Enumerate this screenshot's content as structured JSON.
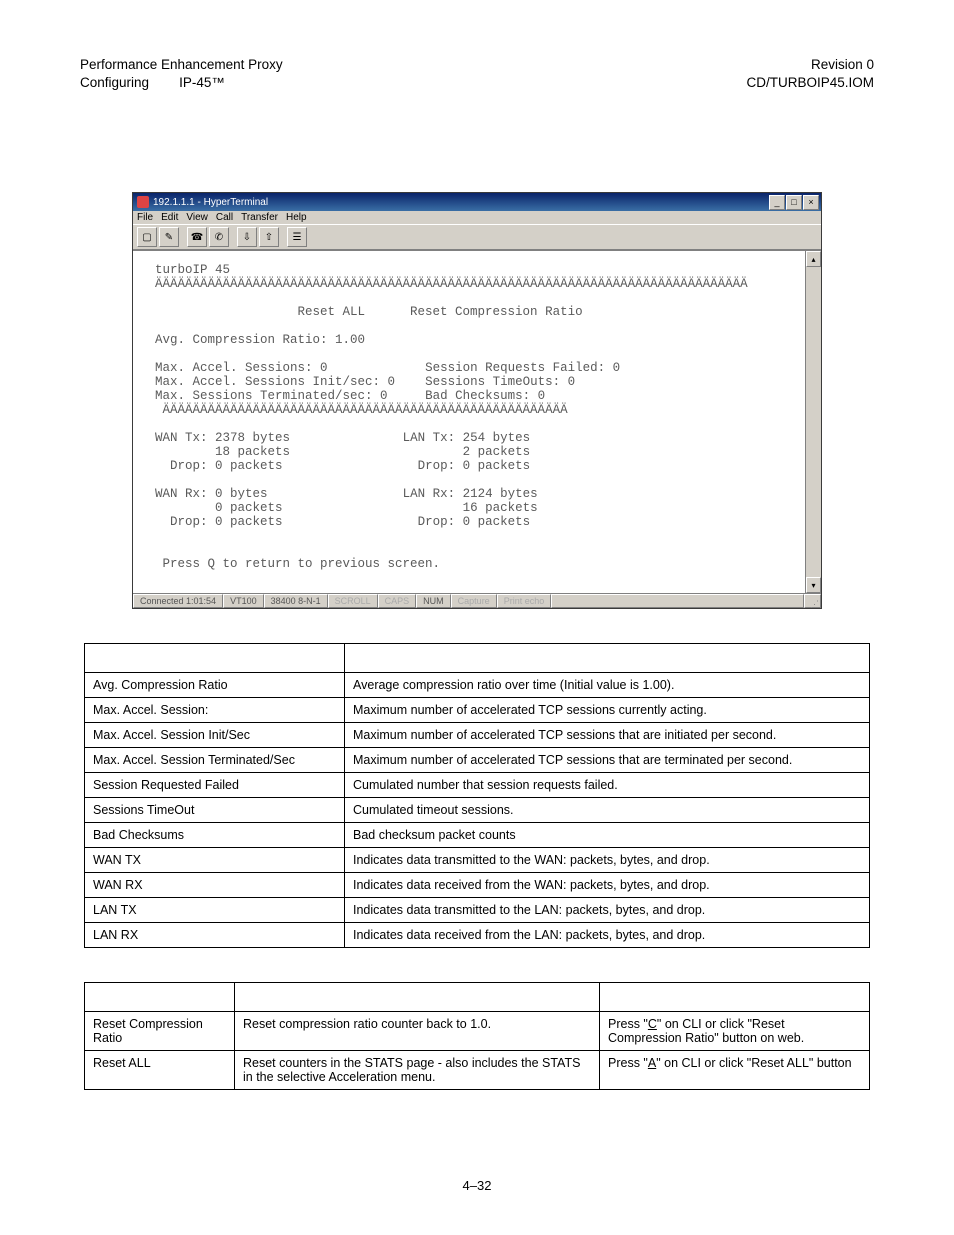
{
  "header": {
    "left_line1": "Performance Enhancement Proxy",
    "left_line2_a": "Configuring",
    "left_line2_b": "IP-45™",
    "right_line1": "Revision 0",
    "right_line2": "CD/TURBOIP45.IOM"
  },
  "hyperterminal": {
    "title": "192.1.1.1 - HyperTerminal",
    "menu": [
      "File",
      "Edit",
      "View",
      "Call",
      "Transfer",
      "Help"
    ],
    "toolbar_icons": [
      "new-doc-icon",
      "open-icon",
      "connect-icon",
      "disconnect-icon",
      "send-icon",
      "receive-icon",
      "properties-icon"
    ],
    "win_buttons": {
      "min": "_",
      "max": "□",
      "close": "×"
    },
    "terminal": {
      "banner1": "turboIP 45",
      "banner2": "ÄÄÄÄÄÄÄÄÄÄÄÄÄÄÄÄÄÄÄÄÄÄÄÄÄÄÄÄÄÄÄÄÄÄÄÄÄÄÄÄÄÄÄÄÄÄÄÄÄÄÄÄÄÄÄÄÄÄÄÄÄÄÄÄÄÄÄÄÄÄÄÄÄÄÄÄÄÄÄ",
      "reset_line": "                   Reset ALL      Reset Compression Ratio",
      "avg": "Avg. Compression Ratio: 1.00",
      "l1a": "Max. Accel. Sessions: 0",
      "l1b": "Session Requests Failed: 0",
      "l2a": "Max. Accel. Sessions Init/sec: 0",
      "l2b": "Sessions TimeOuts: 0",
      "l3a": "Max. Sessions Terminated/sec: 0",
      "l3b": "Bad Checksums: 0",
      "sep": " ÄÄÄÄÄÄÄÄÄÄÄÄÄÄÄÄÄÄÄÄÄÄÄÄÄÄÄÄÄÄÄÄÄÄÄÄÄÄÄÄÄÄÄÄÄÄÄÄÄÄÄÄÄÄ",
      "wtx1": "WAN Tx: 2378 bytes",
      "ltx1": "LAN Tx: 254 bytes",
      "wtx2": "        18 packets",
      "ltx2": "        2 packets",
      "wtx3": "  Drop: 0 packets",
      "ltx3": "  Drop: 0 packets",
      "wrx1": "WAN Rx: 0 bytes",
      "lrx1": "LAN Rx: 2124 bytes",
      "wrx2": "        0 packets",
      "lrx2": "        16 packets",
      "wrx3": "  Drop: 0 packets",
      "lrx3": "  Drop: 0 packets",
      "footer": " Press Q to return to previous screen."
    },
    "status": {
      "conn": "Connected 1:01:54",
      "emul": "VT100",
      "baud": "38400 8-N-1",
      "scroll": "SCROLL",
      "caps": "CAPS",
      "num": "NUM",
      "capture": "Capture",
      "echo": "Print echo"
    }
  },
  "table1": {
    "rows": [
      [
        "Avg. Compression Ratio",
        "Average compression ratio over time (Initial value is 1.00)."
      ],
      [
        "Max. Accel. Session:",
        "Maximum number of accelerated TCP sessions currently acting."
      ],
      [
        "Max. Accel. Session Init/Sec",
        "Maximum number of accelerated TCP sessions that are initiated per second."
      ],
      [
        "Max. Accel. Session Terminated/Sec",
        "Maximum number of accelerated TCP sessions that are terminated per second."
      ],
      [
        "Session Requested Failed",
        "Cumulated number that session requests failed."
      ],
      [
        "Sessions TimeOut",
        "Cumulated timeout sessions."
      ],
      [
        "Bad Checksums",
        "Bad checksum packet counts"
      ],
      [
        "WAN TX",
        "Indicates data transmitted to the WAN: packets, bytes, and drop."
      ],
      [
        "WAN RX",
        "Indicates data received from the WAN: packets, bytes, and drop."
      ],
      [
        "LAN TX",
        "Indicates data transmitted to the LAN: packets, bytes, and drop."
      ],
      [
        "LAN RX",
        "Indicates data received from the LAN: packets, bytes, and drop."
      ]
    ]
  },
  "table2": {
    "rows": [
      {
        "c0": "Reset Compression Ratio",
        "c1": "Reset compression ratio counter back to 1.0.",
        "c2_pre": "Press \"",
        "c2_key": "C",
        "c2_post": "\" on CLI or click \"Reset Compression Ratio\" button on web."
      },
      {
        "c0": "Reset ALL",
        "c1": "Reset counters in the STATS page - also includes the STATS in the selective Acceleration menu.",
        "c2_pre": "Press \"",
        "c2_key": "A",
        "c2_post": "\" on CLI or click \"Reset ALL\" button"
      }
    ]
  },
  "page_number": "4–32"
}
